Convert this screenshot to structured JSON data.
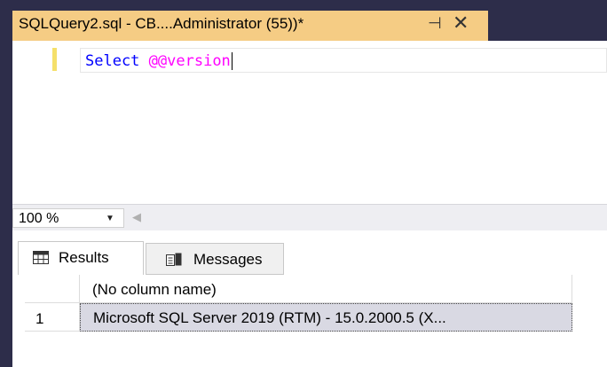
{
  "tab": {
    "title": "SQLQuery2.sql - CB....Administrator (55))*",
    "pin_glyph": "⊣",
    "close_glyph": "✕"
  },
  "editor": {
    "keyword": "Select",
    "system_variable": "@@version"
  },
  "zoom": {
    "value": "100 %",
    "dropdown_glyph": "▼",
    "scroll_left_glyph": "◀"
  },
  "results_tabs": [
    {
      "label": "Results",
      "icon": "grid-icon"
    },
    {
      "label": "Messages",
      "icon": "messages-icon"
    }
  ],
  "grid": {
    "column_header": "(No column name)",
    "rows": [
      {
        "number": "1",
        "value": "Microsoft SQL Server 2019 (RTM) - 15.0.2000.5 (X..."
      }
    ]
  },
  "colors": {
    "active_tab": "#f5cc84",
    "frame": "#2d2d4a",
    "keyword": "#0000ff",
    "system_variable": "#ff00ff",
    "selected_cell": "#d9d9e3"
  }
}
